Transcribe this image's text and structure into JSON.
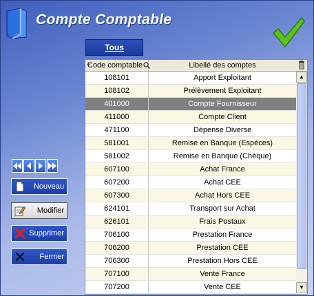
{
  "header": {
    "title": "Compte Comptable",
    "book_icon": "book-icon",
    "validate_icon": "checkmark-icon",
    "accent_color": "#2a4fbf"
  },
  "filter": {
    "all_label": "Tous"
  },
  "grid": {
    "columns": [
      "Code comptable",
      "Libellé des comptes"
    ],
    "header_icons": [
      "sort-up-icon",
      "search-icon",
      "trash-icon"
    ],
    "selected_index": 2,
    "rows": [
      {
        "code": "108101",
        "label": "Apport Exploitant"
      },
      {
        "code": "108102",
        "label": "Prélèvement Exploitant"
      },
      {
        "code": "401000",
        "label": "Compte Fournisseur"
      },
      {
        "code": "411000",
        "label": "Compte Client"
      },
      {
        "code": "471100",
        "label": "Dépense Diverse"
      },
      {
        "code": "581001",
        "label": "Remise en Banque (Espèces)"
      },
      {
        "code": "581002",
        "label": "Remise en Banque (Chèque)"
      },
      {
        "code": "607100",
        "label": "Achat France"
      },
      {
        "code": "607200",
        "label": "Achat CEE"
      },
      {
        "code": "607300",
        "label": "Achat Hors CEE"
      },
      {
        "code": "624101",
        "label": "Transport sur Achat"
      },
      {
        "code": "626101",
        "label": "Frais Postaux"
      },
      {
        "code": "706100",
        "label": "Prestation France"
      },
      {
        "code": "706200",
        "label": "Prestation CEE"
      },
      {
        "code": "706300",
        "label": "Prestation Hors CEE"
      },
      {
        "code": "707100",
        "label": "Vente France"
      },
      {
        "code": "707200",
        "label": "Vente CEE"
      }
    ]
  },
  "navigation": {
    "icons": [
      "first-record-icon",
      "previous-record-icon",
      "next-record-icon",
      "last-record-icon"
    ]
  },
  "actions": {
    "new_label": "Nouveau",
    "edit_label": "Modifier",
    "delete_label": "Supprimer",
    "close_label": "Fermer"
  }
}
